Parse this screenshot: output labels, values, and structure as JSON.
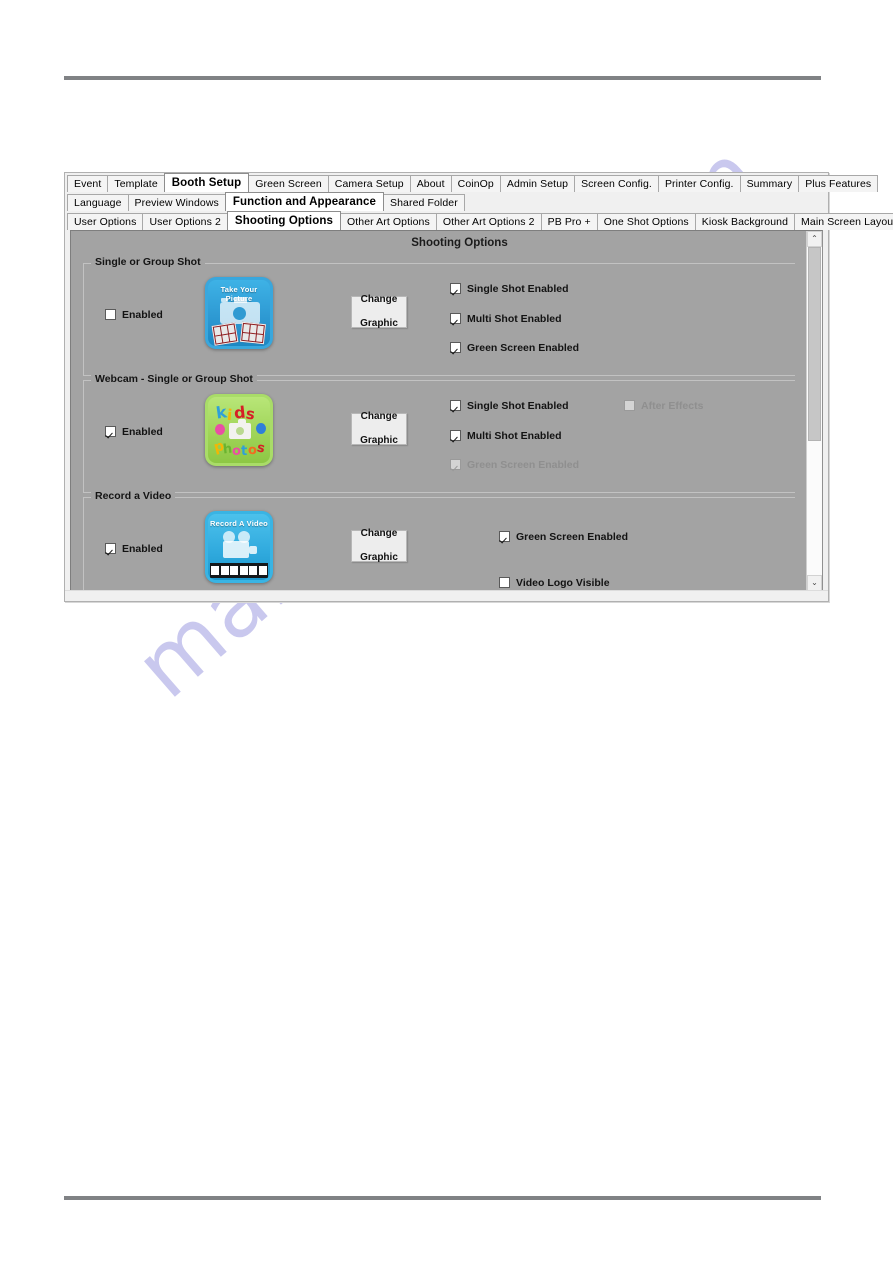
{
  "window": {
    "tabs_level1": [
      {
        "label": "Event",
        "selected": false
      },
      {
        "label": "Template",
        "selected": false
      },
      {
        "label": "Booth Setup",
        "selected": true
      },
      {
        "label": "Green Screen",
        "selected": false
      },
      {
        "label": "Camera Setup",
        "selected": false
      },
      {
        "label": "About",
        "selected": false
      },
      {
        "label": "CoinOp",
        "selected": false
      },
      {
        "label": "Admin Setup",
        "selected": false
      },
      {
        "label": "Screen Config.",
        "selected": false
      },
      {
        "label": "Printer Config.",
        "selected": false
      },
      {
        "label": "Summary",
        "selected": false
      },
      {
        "label": "Plus Features",
        "selected": false
      }
    ],
    "tabs_level2": [
      {
        "label": "Language",
        "selected": false
      },
      {
        "label": "Preview Windows",
        "selected": false
      },
      {
        "label": "Function and Appearance",
        "selected": true
      },
      {
        "label": "Shared Folder",
        "selected": false
      }
    ],
    "tabs_level3": [
      {
        "label": "User Options",
        "selected": false
      },
      {
        "label": "User Options 2",
        "selected": false
      },
      {
        "label": "Shooting Options",
        "selected": true
      },
      {
        "label": "Other Art Options",
        "selected": false
      },
      {
        "label": "Other Art Options 2",
        "selected": false
      },
      {
        "label": "PB Pro +",
        "selected": false
      },
      {
        "label": "One Shot Options",
        "selected": false
      },
      {
        "label": "Kiosk Background",
        "selected": false
      },
      {
        "label": "Main Screen Layout",
        "selected": false
      }
    ]
  },
  "panel": {
    "title": "Shooting Options",
    "background_color": "#a3a3a3"
  },
  "sections": [
    {
      "title": "Single or Group Shot",
      "enabled_label": "Enabled",
      "enabled_checked": false,
      "enabled_disabled": false,
      "change_graphic_line1": "Change",
      "change_graphic_line2": "Graphic",
      "thumbnail_caption": "Take Your Picture",
      "options": [
        {
          "label": "Single Shot Enabled",
          "checked": true,
          "disabled": false
        },
        {
          "label": "Multi Shot Enabled",
          "checked": true,
          "disabled": false
        },
        {
          "label": "Green Screen Enabled",
          "checked": true,
          "disabled": false
        }
      ],
      "extra_options": []
    },
    {
      "title": "Webcam - Single or Group Shot",
      "enabled_label": "Enabled",
      "enabled_checked": true,
      "enabled_disabled": false,
      "change_graphic_line1": "Change",
      "change_graphic_line2": "Graphic",
      "thumbnail_caption": "kids photos",
      "options": [
        {
          "label": "Single Shot Enabled",
          "checked": true,
          "disabled": false
        },
        {
          "label": "Multi Shot Enabled",
          "checked": true,
          "disabled": false
        },
        {
          "label": "Green Screen Enabled",
          "checked": true,
          "disabled": true
        }
      ],
      "extra_options": [
        {
          "label": "After Effects",
          "checked": false,
          "disabled": true
        }
      ]
    },
    {
      "title": "Record a Video",
      "enabled_label": "Enabled",
      "enabled_checked": true,
      "enabled_disabled": false,
      "change_graphic_line1": "Change",
      "change_graphic_line2": "Graphic",
      "thumbnail_caption": "Record A Video",
      "options": [
        {
          "label": "Green Screen Enabled",
          "checked": true,
          "disabled": false
        },
        {
          "label": "Video Logo Visible",
          "checked": false,
          "disabled": false
        }
      ],
      "extra_options": []
    }
  ],
  "scrollbar": {
    "up_arrow": "⌃",
    "down_arrow": "⌄",
    "thumb_percent": 59
  },
  "watermark": {
    "text": "manualshive.com"
  },
  "kids_tile": {
    "word1": "kids",
    "word2": "photos"
  }
}
